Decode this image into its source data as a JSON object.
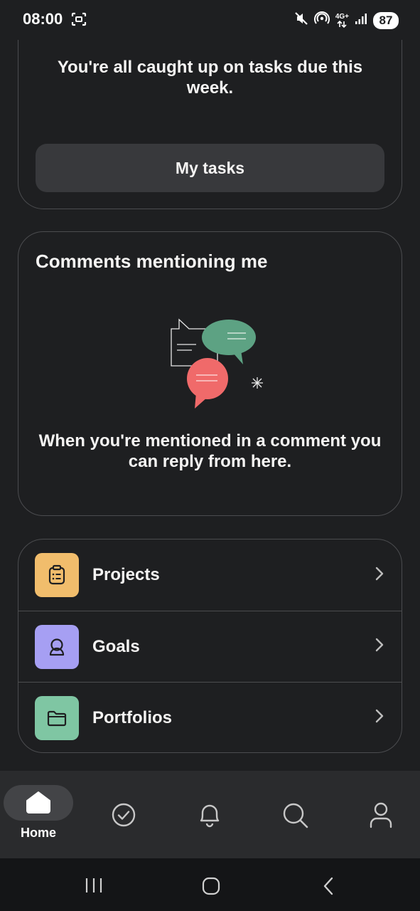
{
  "status_bar": {
    "time": "08:00",
    "network_label_top": "4G+",
    "battery": "87",
    "icons": [
      "screenshot-icon",
      "mute-icon",
      "hotspot-icon",
      "network-4g-icon",
      "signal-icon",
      "battery-icon"
    ]
  },
  "tasks_card": {
    "message": "You're all caught up on tasks due this week.",
    "button_label": "My tasks"
  },
  "comments_card": {
    "title": "Comments mentioning me",
    "empty_message": "When you're mentioned in a comment you can reply from here."
  },
  "links": [
    {
      "label": "Projects",
      "icon": "clipboard-icon",
      "color": "#f1bd6c"
    },
    {
      "label": "Goals",
      "icon": "goal-person-icon",
      "color": "#a69ff3"
    },
    {
      "label": "Portfolios",
      "icon": "folder-icon",
      "color": "#7fc6a3"
    }
  ],
  "bottom_nav": {
    "home_label": "Home",
    "items": [
      "home-icon",
      "my-tasks-icon",
      "inbox-bell-icon",
      "search-icon",
      "account-icon"
    ]
  },
  "colors": {
    "background": "#1e1f21",
    "card_border": "#4b4c4f",
    "button_bg": "#38393c",
    "bubble_green": "#5da283",
    "bubble_red": "#f06a6a"
  }
}
